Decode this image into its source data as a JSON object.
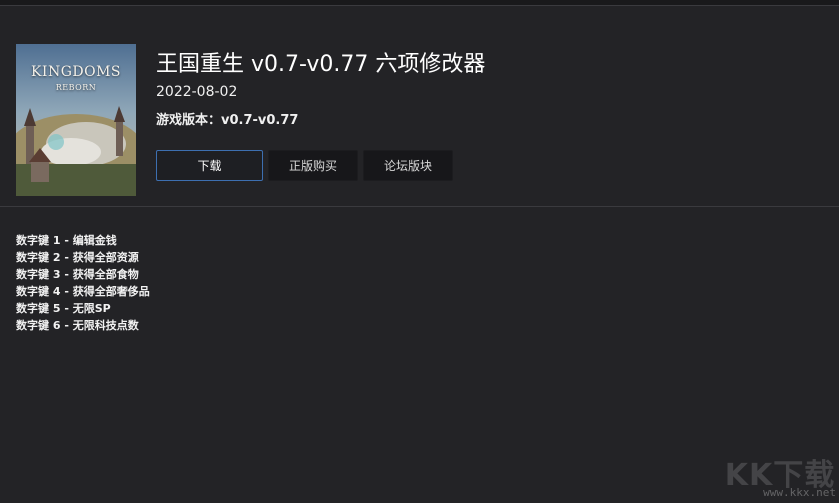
{
  "game": {
    "title": "王国重生 v0.7-v0.77 六项修改器",
    "date": "2022-08-02",
    "version_label": "游戏版本：",
    "version_value": "v0.7-v0.77",
    "cover_logo": "KINGDOMS",
    "cover_sub": "REBORN"
  },
  "buttons": {
    "download": "下载",
    "buy": "正版购买",
    "forum": "论坛版块"
  },
  "hotkeys": [
    "数字键 1 - 编辑金钱",
    "数字键 2 - 获得全部资源",
    "数字键 3 - 获得全部食物",
    "数字键 4 - 获得全部奢侈品",
    "数字键 5 - 无限SP",
    "数字键 6 - 无限科技点数"
  ],
  "watermark": {
    "main": "KK下载",
    "url": "www.kkx.net"
  },
  "colors": {
    "background": "#232326",
    "download_border": "#3d6fb0",
    "button_bg": "#17171a"
  }
}
